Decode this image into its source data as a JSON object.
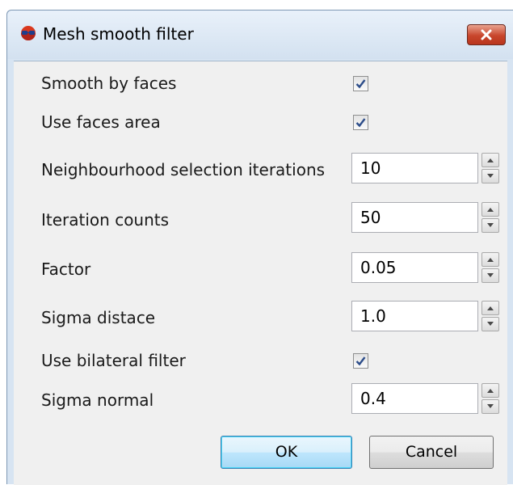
{
  "window": {
    "title": "Mesh smooth filter"
  },
  "rows": [
    {
      "label": "Smooth by faces",
      "type": "checkbox",
      "checked": true
    },
    {
      "label": "Use faces area",
      "type": "checkbox",
      "checked": true
    },
    {
      "label": "Neighbourhood selection iterations",
      "type": "spin",
      "value": "10"
    },
    {
      "label": "Iteration counts",
      "type": "spin",
      "value": "50"
    },
    {
      "label": "Factor",
      "type": "spin",
      "value": "0.05"
    },
    {
      "label": "Sigma distace",
      "type": "spin",
      "value": "1.0"
    },
    {
      "label": "Use bilateral filter",
      "type": "checkbox",
      "checked": true
    },
    {
      "label": "Sigma normal",
      "type": "spin",
      "value": "0.4"
    }
  ],
  "buttons": {
    "ok": "OK",
    "cancel": "Cancel"
  },
  "icons": {
    "app": "sphere-glasses-icon",
    "close": "close-x-icon",
    "spin_up": "arrow-up-icon",
    "spin_down": "arrow-down-icon",
    "check": "checkmark-icon"
  },
  "colors": {
    "frame": "#d7e4f2",
    "client": "#f0f0f0",
    "close_button": "#c8462c",
    "checkmark": "#2d4d8a",
    "ok_border": "#3c7fb1"
  }
}
